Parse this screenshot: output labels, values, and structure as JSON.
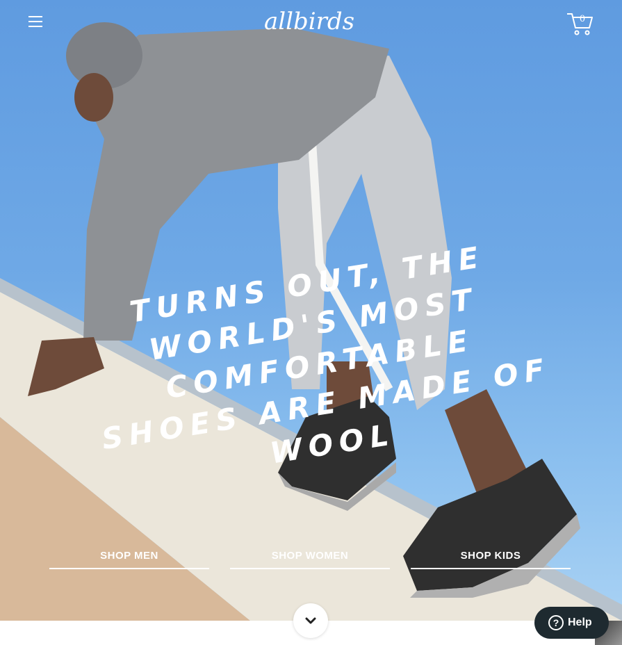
{
  "header": {
    "logo_text": "allbirds",
    "menu_icon": "hamburger-menu-icon",
    "cart_icon": "shopping-cart-icon",
    "cart_count": "0"
  },
  "hero": {
    "headline": "Turns out, the world's most comfortable shoes are made of wool",
    "links": {
      "men": "SHOP MEN",
      "women": "SHOP WOMEN",
      "kids": "SHOP KIDS"
    },
    "scroll_icon": "chevron-down-icon"
  },
  "help": {
    "label": "Help",
    "icon": "question-circle-icon"
  },
  "colors": {
    "sky": "#6fa9e6",
    "help_bg": "#1e2a30",
    "text": "#ffffff"
  }
}
